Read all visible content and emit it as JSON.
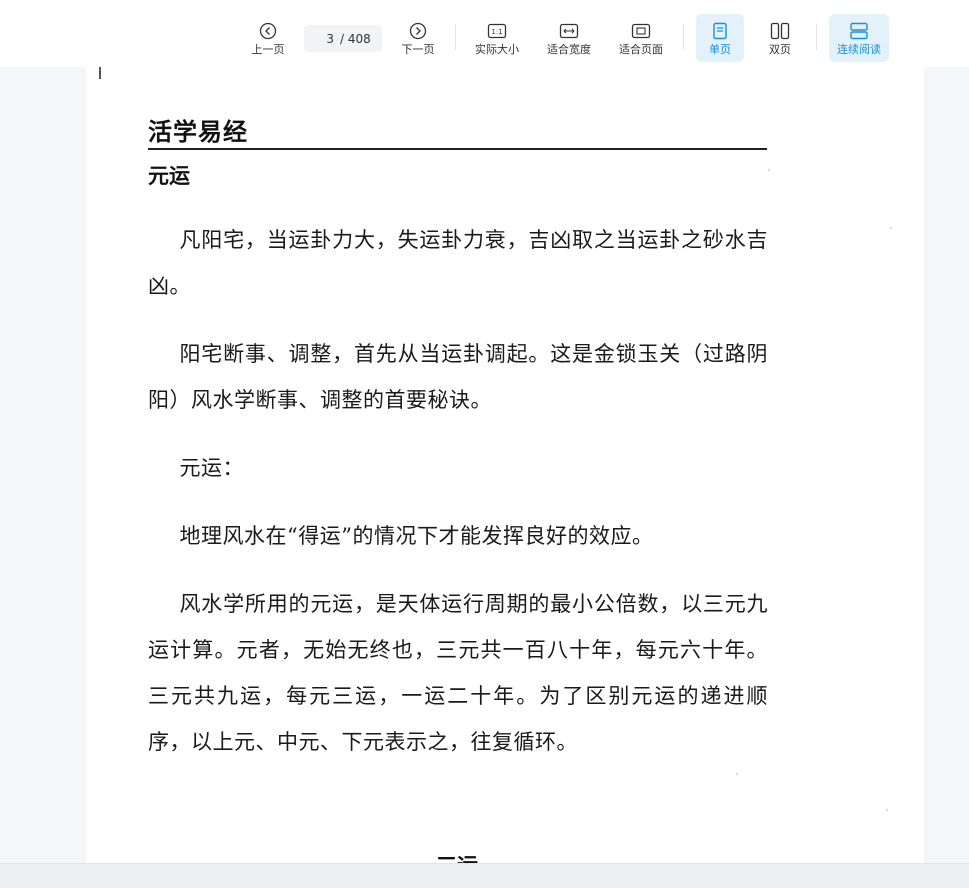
{
  "toolbar": {
    "prev_label": "上一页",
    "next_label": "下一页",
    "current_page": "3",
    "total_pages": "/ 408",
    "actual_size_label": "实际大小",
    "fit_width_label": "适合宽度",
    "fit_page_label": "适合页面",
    "single_page_label": "单页",
    "double_page_label": "双页",
    "continuous_label": "连续阅读",
    "accent_color": "#1a8fd6",
    "active_bg": "#e3f1fb"
  },
  "document": {
    "header_title": "活学易经",
    "section_title": "元运",
    "paragraphs": [
      "凡阳宅，当运卦力大，失运卦力衰，吉凶取之当运卦之砂水吉凶。",
      "阳宅断事、调整，首先从当运卦调起。这是金锁玉关（过路阴阳）风水学断事、调整的首要秘诀。",
      "元运：",
      "地理风水在“得运”的情况下才能发挥良好的效应。",
      "风水学所用的元运，是天体运行周期的最小公倍数，以三元九运计算。元者，无始无终也，三元共一百八十年，每元六十年。三元共九运，每元三运，一运二十年。为了区别元运的递进顺序，以上元、中元、下元表示之，往复循环。"
    ],
    "next_page_partial_heading": "三运"
  }
}
